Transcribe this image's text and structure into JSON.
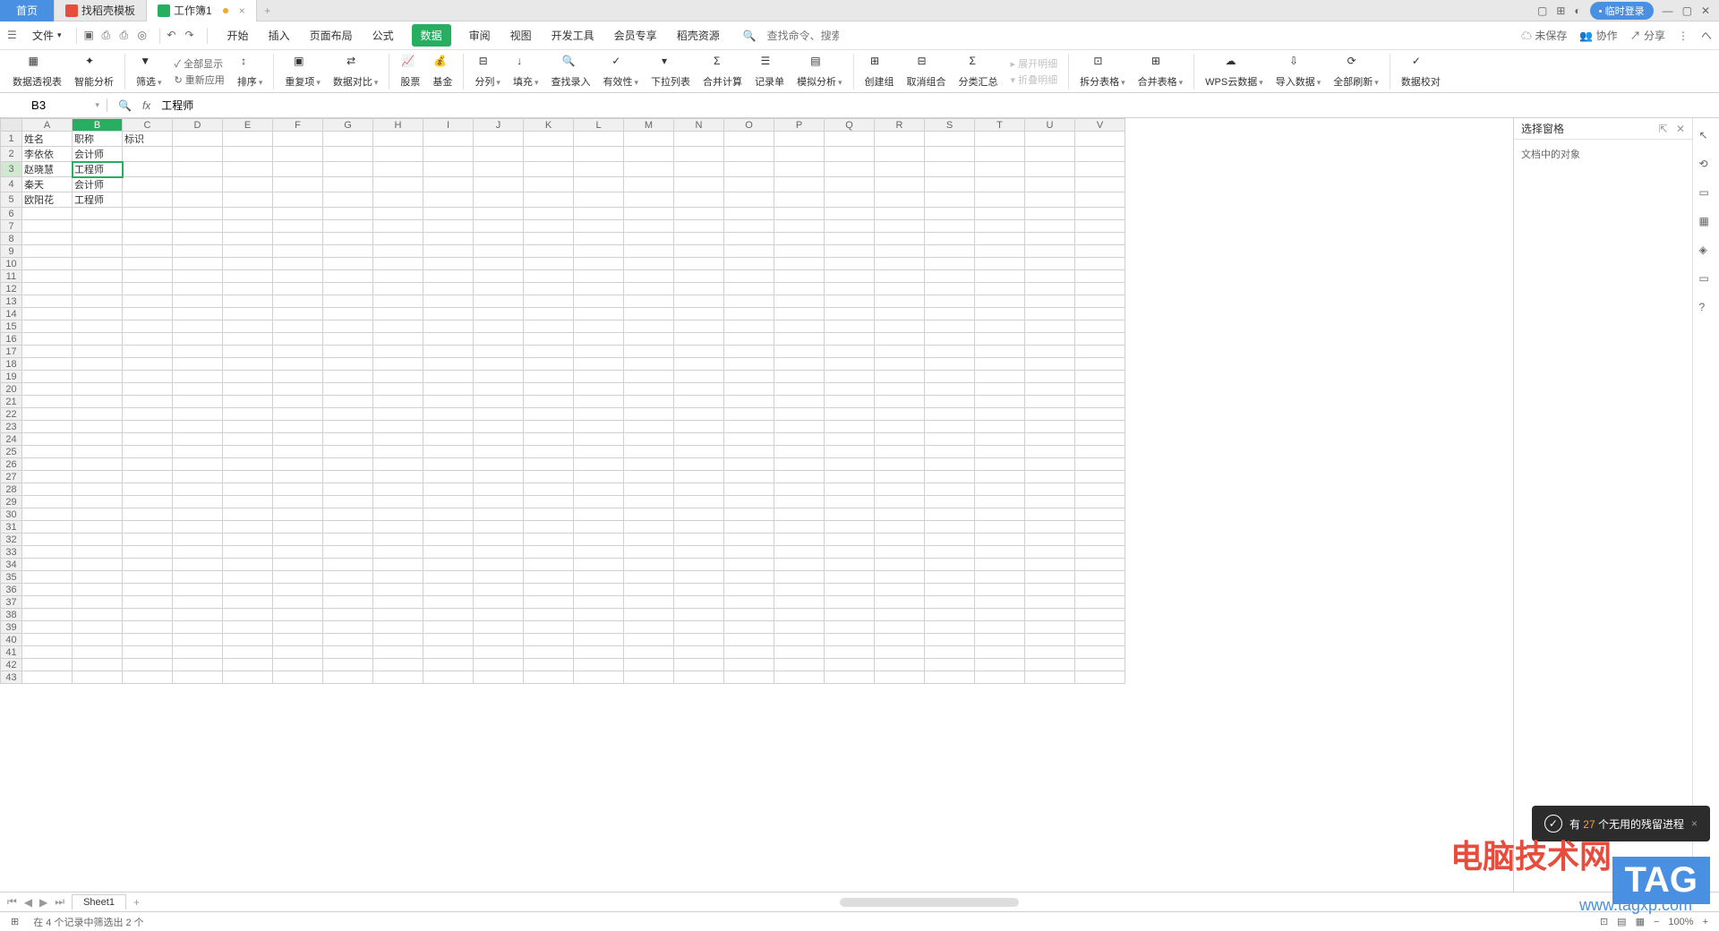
{
  "titlebar": {
    "home": "首页",
    "tab1": "找稻壳模板",
    "tab2": "工作簿1",
    "login": "临时登录"
  },
  "menubar": {
    "file": "文件",
    "tabs": [
      "开始",
      "插入",
      "页面布局",
      "公式",
      "数据",
      "审阅",
      "视图",
      "开发工具",
      "会员专享",
      "稻壳资源"
    ],
    "active_index": 4,
    "search_cmd_ph": "查找命令、搜索模板",
    "unsaved": "未保存",
    "coop": "协作",
    "share": "分享"
  },
  "ribbon": {
    "items": [
      {
        "label": "数据透视表"
      },
      {
        "label": "智能分析"
      },
      {
        "label": "筛选"
      },
      {
        "label": "排序"
      },
      {
        "label": "重复项"
      },
      {
        "label": "数据对比"
      },
      {
        "label": "股票"
      },
      {
        "label": "基金"
      },
      {
        "label": "分列"
      },
      {
        "label": "填充"
      },
      {
        "label": "查找录入"
      },
      {
        "label": "有效性"
      },
      {
        "label": "下拉列表"
      },
      {
        "label": "合并计算"
      },
      {
        "label": "记录单"
      },
      {
        "label": "模拟分析"
      },
      {
        "label": "创建组"
      },
      {
        "label": "取消组合"
      },
      {
        "label": "分类汇总"
      },
      {
        "label": "拆分表格"
      },
      {
        "label": "合并表格"
      },
      {
        "label": "WPS云数据"
      },
      {
        "label": "导入数据"
      },
      {
        "label": "全部刷新"
      },
      {
        "label": "数据校对"
      }
    ],
    "small": {
      "show_all": "全部显示",
      "reapply": "重新应用",
      "expand": "展开明细",
      "collapse": "折叠明细"
    }
  },
  "formula": {
    "cell_ref": "B3",
    "value": "工程师"
  },
  "columns": [
    "A",
    "B",
    "C",
    "D",
    "E",
    "F",
    "G",
    "H",
    "I",
    "J",
    "K",
    "L",
    "M",
    "N",
    "O",
    "P",
    "Q",
    "R",
    "S",
    "T",
    "U",
    "V"
  ],
  "row_count": 43,
  "selected": {
    "row": 3,
    "col": 1
  },
  "data": {
    "1": {
      "A": "姓名",
      "B": "职称",
      "C": "标识"
    },
    "2": {
      "A": "李依依",
      "B": "会计师"
    },
    "3": {
      "A": "赵晓慧",
      "B": "工程师"
    },
    "4": {
      "A": "秦天",
      "B": "会计师"
    },
    "5": {
      "A": "欧阳花",
      "B": "工程师"
    }
  },
  "sidepanel": {
    "title": "选择窗格",
    "body": "文档中的对象"
  },
  "sheettabs": {
    "sheet1": "Sheet1"
  },
  "statusbar": {
    "text": "在 4 个记录中筛选出 2 个",
    "zoom": "100%"
  },
  "toast": {
    "prefix": "有 ",
    "count": "27",
    "suffix": " 个无用的残留进程"
  },
  "watermark": {
    "brand": "电脑技术网",
    "url": "www.tagxp.com",
    "tag": "TAG"
  }
}
